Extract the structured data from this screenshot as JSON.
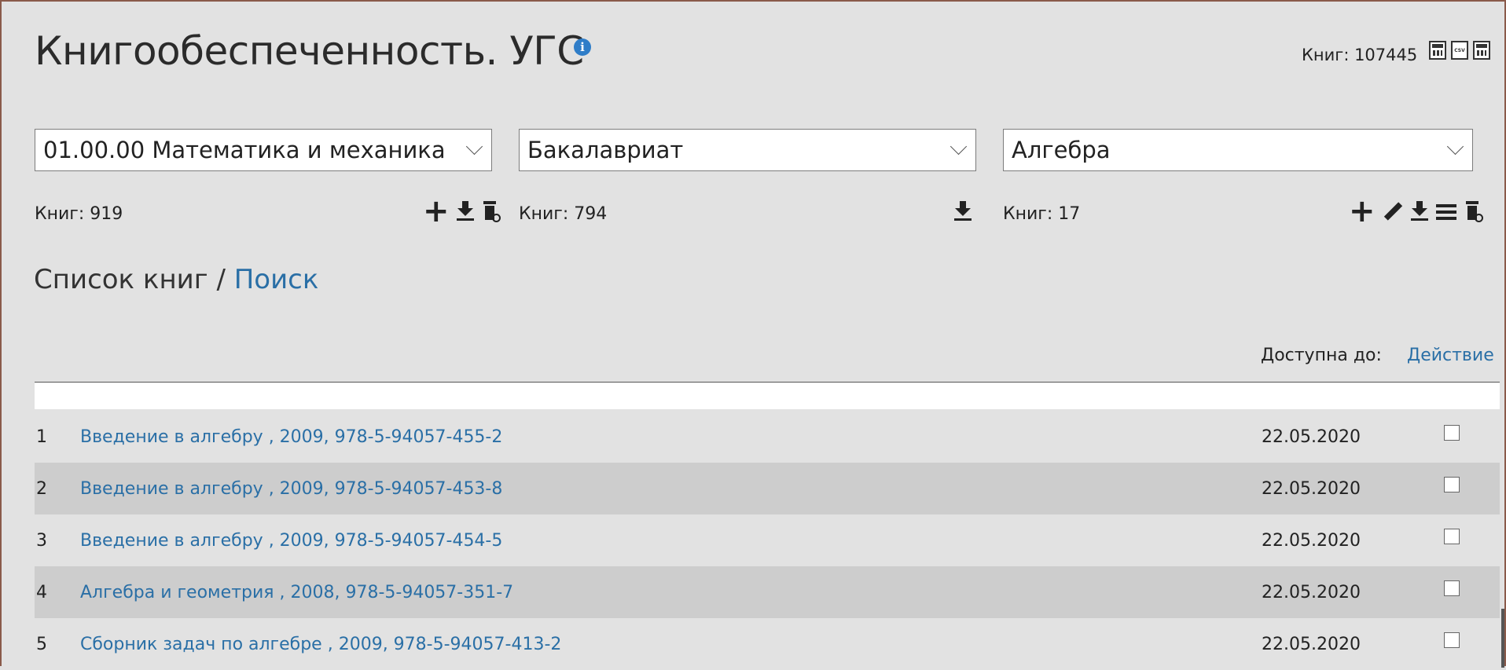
{
  "page": {
    "title": "Книгообеспеченность. УГС",
    "info_icon": "i",
    "total_count": "Книг: 107445",
    "export_icons": [
      "calculator-icon",
      "csv-file-icon",
      "calculator-icon"
    ]
  },
  "filters": {
    "direction": {
      "value": "01.00.00 Математика и механика",
      "count": "Книг: 919"
    },
    "level": {
      "value": "Бакалавриат",
      "count": "Книг: 794"
    },
    "subject": {
      "value": "Алгебра",
      "count": "Книг: 17"
    }
  },
  "list": {
    "title": "Список книг / ",
    "search_link": "Поиск",
    "header_available": "Доступна до:",
    "header_action": "Действие",
    "rows": [
      {
        "num": "1",
        "book": "Введение в алгебру , 2009, 978-5-94057-455-2",
        "date": "22.05.2020"
      },
      {
        "num": "2",
        "book": "Введение в алгебру , 2009, 978-5-94057-453-8",
        "date": "22.05.2020"
      },
      {
        "num": "3",
        "book": "Введение в алгебру , 2009, 978-5-94057-454-5",
        "date": "22.05.2020"
      },
      {
        "num": "4",
        "book": "Алгебра и геометрия , 2008, 978-5-94057-351-7",
        "date": "22.05.2020"
      },
      {
        "num": "5",
        "book": "Сборник задач по алгебре , 2009, 978-5-94057-413-2",
        "date": "22.05.2020"
      }
    ]
  },
  "colors": {
    "link": "#2a6fa6",
    "alt_row": "#cdcdcd",
    "background": "#e2e2e2"
  }
}
